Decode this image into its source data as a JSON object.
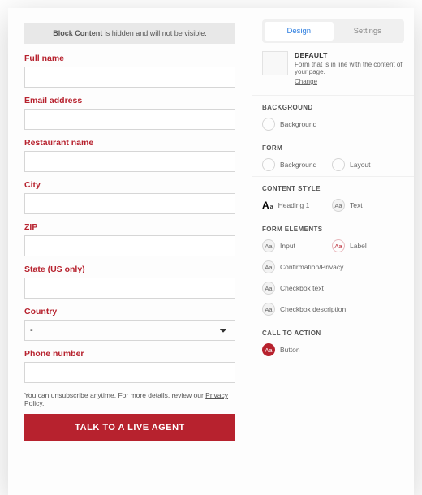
{
  "notice": {
    "prefix": "",
    "bold": "Block Content",
    "suffix": " is hidden and will not be visible."
  },
  "form": {
    "fields": {
      "full_name": "Full name",
      "email": "Email address",
      "restaurant": "Restaurant name",
      "city": "City",
      "zip": "ZIP",
      "state": "State (US only)",
      "country": "Country",
      "country_value": "-",
      "phone": "Phone number"
    },
    "unsub_text": "You can unsubscribe anytime. For more details, review our ",
    "unsub_link": "Privacy Policy",
    "unsub_suffix": ".",
    "cta": "TALK TO A LIVE AGENT"
  },
  "tabs": {
    "design": "Design",
    "settings": "Settings"
  },
  "preset": {
    "title": "DEFAULT",
    "desc": "Form that is in line with the content of your page.",
    "change": "Change"
  },
  "sections": {
    "background": {
      "h": "BACKGROUND",
      "opts": [
        "Background"
      ]
    },
    "formsec": {
      "h": "FORM",
      "opts": [
        "Background",
        "Layout"
      ]
    },
    "content": {
      "h": "CONTENT STYLE",
      "h1": "Heading 1",
      "text": "Text"
    },
    "elements": {
      "h": "FORM ELEMENTS",
      "input": "Input",
      "label": "Label",
      "confirm": "Confirmation/Privacy",
      "cbtext": "Checkbox text",
      "cbdesc": "Checkbox description"
    },
    "cta": {
      "h": "CALL TO ACTION",
      "btn": "Button"
    }
  }
}
